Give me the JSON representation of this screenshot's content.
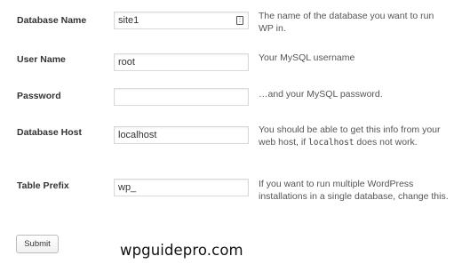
{
  "form": {
    "fields": [
      {
        "label": "Database Name",
        "value": "site1",
        "description": "The name of the database you want to run WP in."
      },
      {
        "label": "User Name",
        "value": "root",
        "description": "Your MySQL username"
      },
      {
        "label": "Password",
        "value": "",
        "description": "…and your MySQL password."
      },
      {
        "label": "Database Host",
        "value": "localhost",
        "description_before": "You should be able to get this info from your web host, if ",
        "description_code": "localhost",
        "description_after": " does not work."
      },
      {
        "label": "Table Prefix",
        "value": "wp_",
        "description": "If you want to run multiple WordPress installations in a single database, change this."
      }
    ],
    "submit_label": "Submit",
    "autofill_icon": "autofill-key-icon"
  },
  "watermark": "wpguidepro.com"
}
